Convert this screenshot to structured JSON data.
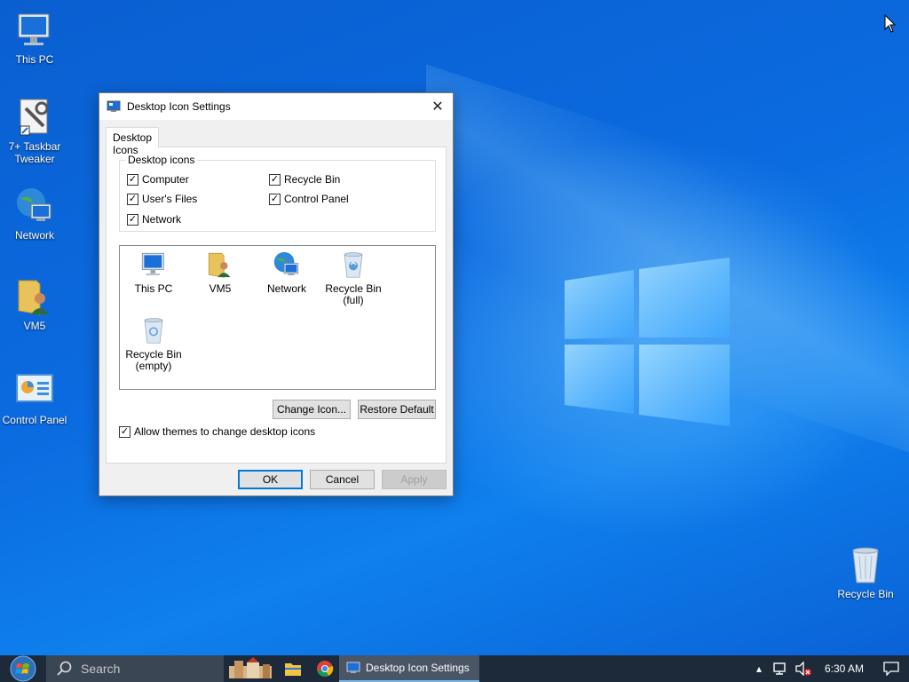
{
  "desktop": {
    "icons": [
      {
        "label": "This PC",
        "icon": "this-pc-icon"
      },
      {
        "label": "7+ Taskbar Tweaker",
        "icon": "taskbar-tweaker-icon"
      },
      {
        "label": "Network",
        "icon": "network-icon"
      },
      {
        "label": "VM5",
        "icon": "user-folder-icon"
      },
      {
        "label": "Control Panel",
        "icon": "control-panel-icon"
      },
      {
        "label": "Recycle Bin",
        "icon": "recycle-bin-icon"
      }
    ]
  },
  "dialog": {
    "title": "Desktop Icon Settings",
    "tab": "Desktop Icons",
    "group_label": "Desktop icons",
    "checkboxes": [
      {
        "label": "Computer",
        "checked": true
      },
      {
        "label": "Recycle Bin",
        "checked": true
      },
      {
        "label": "User's Files",
        "checked": true
      },
      {
        "label": "Control Panel",
        "checked": true
      },
      {
        "label": "Network",
        "checked": true
      }
    ],
    "icon_list": [
      {
        "label": "This PC",
        "icon": "this-pc-icon"
      },
      {
        "label": "VM5",
        "icon": "user-folder-icon"
      },
      {
        "label": "Network",
        "icon": "network-icon"
      },
      {
        "label": "Recycle Bin (full)",
        "icon": "recycle-bin-full-icon"
      },
      {
        "label": "Recycle Bin (empty)",
        "icon": "recycle-bin-empty-icon"
      }
    ],
    "change_icon_label": "Change Icon...",
    "restore_default_label": "Restore Default",
    "allow_themes_label": "Allow themes to change desktop icons",
    "allow_themes_checked": true,
    "ok_label": "OK",
    "cancel_label": "Cancel",
    "apply_label": "Apply"
  },
  "taskbar": {
    "search_placeholder": "Search",
    "active_app": "Desktop Icon Settings",
    "clock": "6:30 AM"
  },
  "colors": {
    "accent": "#0078d7",
    "taskbar": "#1c2a39",
    "wallpaper": "#0a5fd0"
  }
}
